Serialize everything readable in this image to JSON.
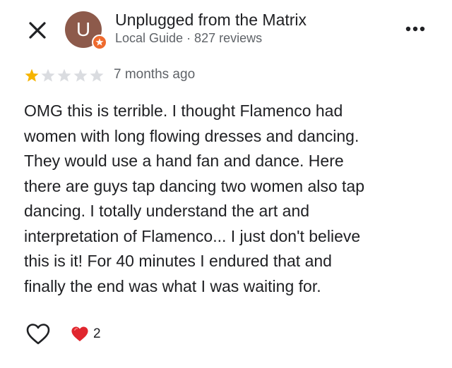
{
  "header": {
    "avatar_letter": "U",
    "reviewer_name": "Unplugged from the Matrix",
    "reviewer_meta": "Local Guide · 827 reviews"
  },
  "review": {
    "rating": 1,
    "max_rating": 5,
    "date": "7 months ago",
    "lines": [
      "OMG this is terrible. I thought Flamenco had",
      "women with long flowing dresses and dancing.",
      "They would use a hand fan and dance. Here",
      "there are guys tap dancing two women also tap",
      "dancing. I totally understand the art and",
      "interpretation of Flamenco... I just don't believe",
      "this is it! For 40 minutes I endured that and",
      "finally the end was what I was waiting for."
    ]
  },
  "reactions": {
    "count": "2"
  },
  "icons": {
    "close": "close-icon",
    "more": "more-options-icon",
    "badge": "local-guide-star-icon",
    "like": "heart-outline-icon",
    "reaction": "red-heart-icon"
  },
  "colors": {
    "avatar": "#8d5a4b",
    "badge": "#ee6a2e",
    "star_filled": "#f6b400",
    "star_empty": "#dadce0",
    "heart_reaction": "#e0262e",
    "secondary_text": "#5f6368"
  }
}
